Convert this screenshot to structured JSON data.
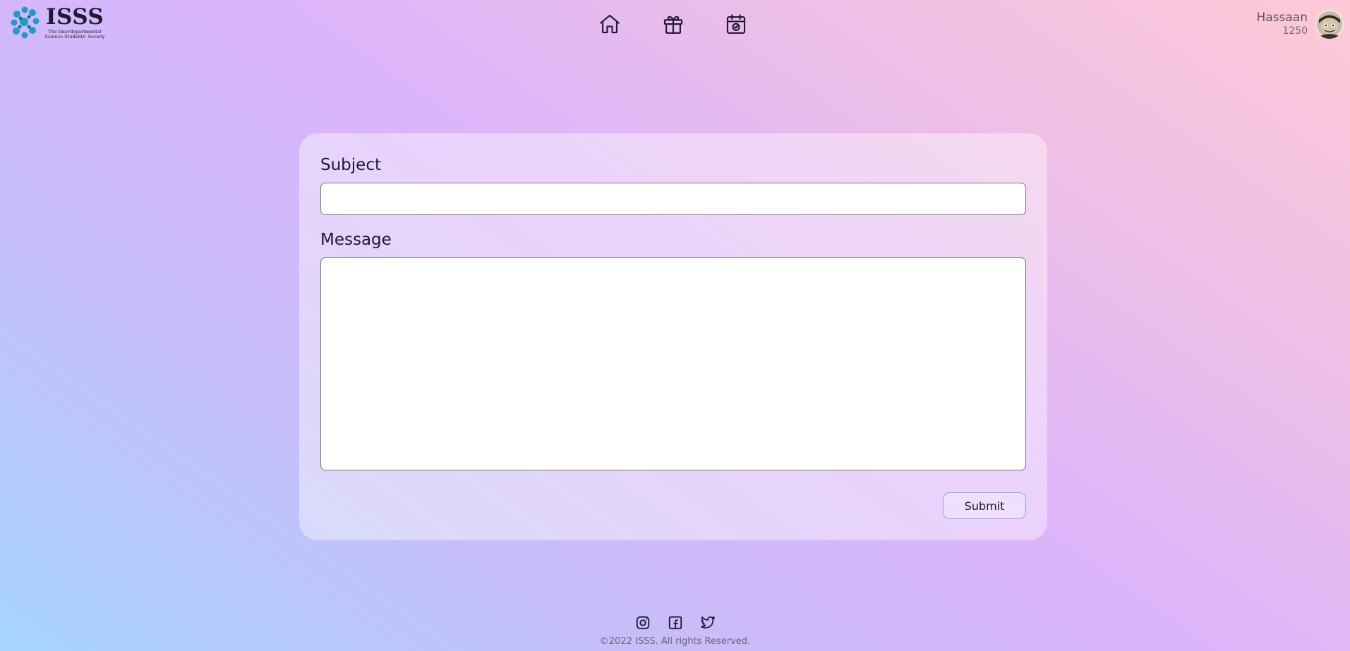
{
  "header": {
    "logo": {
      "title": "ISSS",
      "subtitle_line1": "The Interdepartmental",
      "subtitle_line2": "Science Students' Society"
    },
    "nav": [
      {
        "icon": "home-icon"
      },
      {
        "icon": "gift-icon"
      },
      {
        "icon": "calendar-check-icon"
      }
    ],
    "user": {
      "name": "Hassaan",
      "points": "1250"
    }
  },
  "form": {
    "subject_label": "Subject",
    "subject_value": "",
    "message_label": "Message",
    "message_value": "",
    "submit_label": "Submit"
  },
  "footer": {
    "social": [
      "instagram-icon",
      "facebook-icon",
      "twitter-icon"
    ],
    "copyright": "©2022 ISSS. All rights Reserved."
  }
}
